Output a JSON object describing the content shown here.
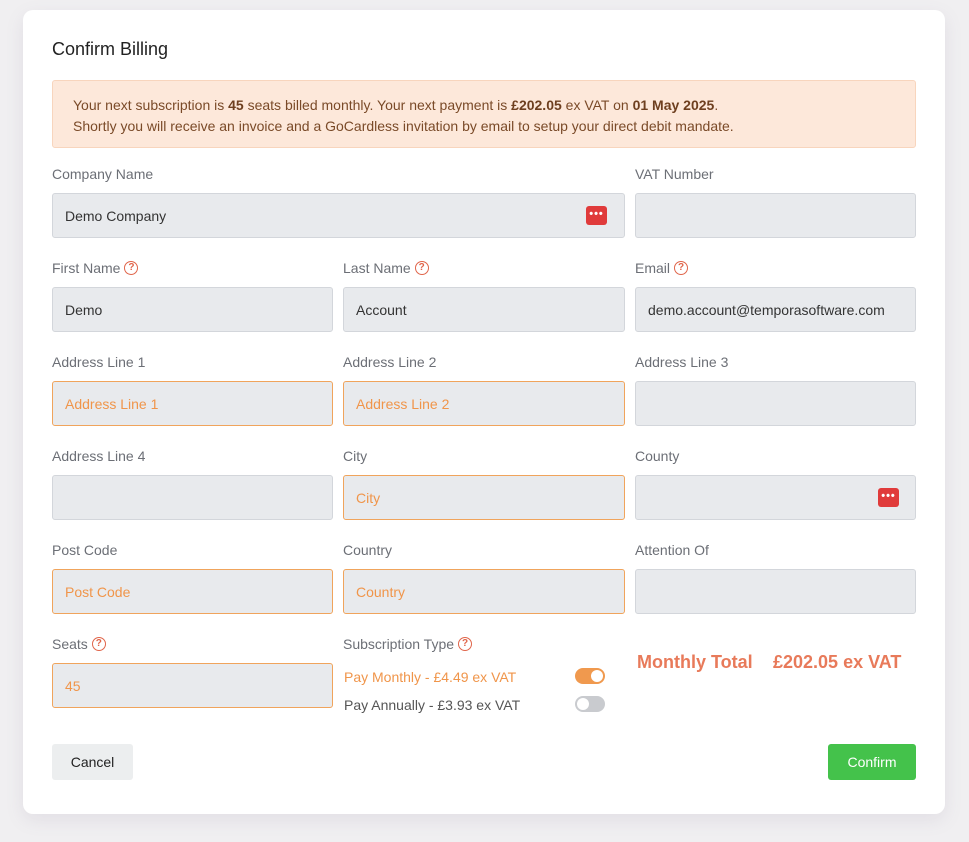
{
  "dialog": {
    "title": "Confirm Billing",
    "notice": {
      "t1": "Your next subscription is ",
      "seats": "45",
      "t2": " seats billed monthly. Your next payment is ",
      "amount": "£202.05",
      "t3": " ex VAT on ",
      "date": "01 May 2025",
      "t4": ".",
      "line2": "Shortly you will receive an invoice and a GoCardless invitation by email to setup your direct debit mandate."
    }
  },
  "form": {
    "company_name": {
      "label": "Company Name",
      "value": "Demo Company",
      "placeholder": ""
    },
    "vat_number": {
      "label": "VAT Number",
      "value": "",
      "placeholder": ""
    },
    "first_name": {
      "label": "First Name",
      "value": "Demo",
      "placeholder": ""
    },
    "last_name": {
      "label": "Last Name",
      "value": "Account",
      "placeholder": ""
    },
    "email": {
      "label": "Email",
      "value": "demo.account@temporasoftware.com",
      "placeholder": ""
    },
    "address1": {
      "label": "Address Line 1",
      "value": "",
      "placeholder": "Address Line 1"
    },
    "address2": {
      "label": "Address Line 2",
      "value": "",
      "placeholder": "Address Line 2"
    },
    "address3": {
      "label": "Address Line 3",
      "value": "",
      "placeholder": ""
    },
    "address4": {
      "label": "Address Line 4",
      "value": "",
      "placeholder": ""
    },
    "city": {
      "label": "City",
      "value": "",
      "placeholder": "City"
    },
    "county": {
      "label": "County",
      "value": "",
      "placeholder": ""
    },
    "post_code": {
      "label": "Post Code",
      "value": "",
      "placeholder": "Post Code"
    },
    "country": {
      "label": "Country",
      "value": "",
      "placeholder": "Country"
    },
    "attention_of": {
      "label": "Attention Of",
      "value": "",
      "placeholder": ""
    },
    "seats": {
      "label": "Seats",
      "value": "45",
      "placeholder": ""
    }
  },
  "subscription": {
    "label": "Subscription Type",
    "monthly": {
      "label": "Pay Monthly - £4.49 ex VAT",
      "on": true
    },
    "annually": {
      "label": "Pay Annually - £3.93 ex VAT",
      "on": false
    }
  },
  "total": {
    "label": "Monthly Total",
    "value": "£202.05 ex VAT"
  },
  "buttons": {
    "cancel": "Cancel",
    "confirm": "Confirm"
  },
  "icons": {
    "help": "question-circle-icon",
    "password_manager": "password-manager-icon"
  },
  "colors": {
    "accent": "#f0954a",
    "confirm": "#44c24b",
    "total": "#e87a5a",
    "notice_bg": "#fde8da"
  }
}
